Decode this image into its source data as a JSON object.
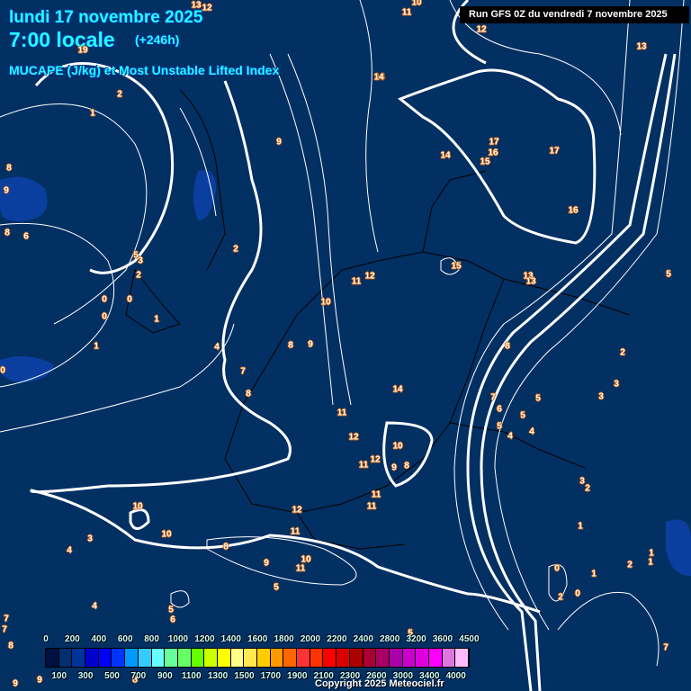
{
  "header": {
    "date": "lundi 17 novembre 2025",
    "time": "7:00 locale",
    "lead": "(+246h)",
    "parameter": "MUCAPE (J/kg) et Most Unstable Lifted Index",
    "run": "Run GFS 0Z du vendredi 7 novembre 2025"
  },
  "contour_labels": [
    "13",
    "12",
    "11",
    "10",
    "12",
    "14",
    "13",
    "19",
    "2",
    "1",
    "9",
    "8",
    "9",
    "8",
    "6",
    "5",
    "3",
    "2",
    "0",
    "0",
    "0",
    "1",
    "1",
    "2",
    "4",
    "7",
    "8",
    "8",
    "9",
    "10",
    "11",
    "12",
    "14",
    "15",
    "17",
    "16",
    "17",
    "16",
    "14",
    "15",
    "13",
    "13",
    "5",
    "8",
    "7",
    "6",
    "5",
    "5",
    "4",
    "4",
    "5",
    "3",
    "2",
    "3",
    "3",
    "2",
    "1",
    "1",
    "0",
    "0",
    "2",
    "2",
    "1",
    "1",
    "14",
    "11",
    "12",
    "11",
    "10",
    "9",
    "8",
    "12",
    "11",
    "11",
    "12",
    "11",
    "10",
    "10",
    "8",
    "4",
    "3",
    "9",
    "5",
    "6",
    "4",
    "5",
    "10",
    "11",
    "7",
    "8",
    "9",
    "7",
    "9",
    "8",
    "7",
    "5",
    "0"
  ],
  "colorbar": {
    "colors": [
      "#001040",
      "#003070",
      "#003399",
      "#0000cc",
      "#0000ff",
      "#0033ff",
      "#0099ff",
      "#33ccff",
      "#66ffff",
      "#66ff99",
      "#66ff66",
      "#66ff00",
      "#ccff00",
      "#ffff00",
      "#ffff88",
      "#ffe850",
      "#ffcc00",
      "#ff9900",
      "#ff6600",
      "#ff3333",
      "#ff3300",
      "#ff0000",
      "#dd0000",
      "#aa0000",
      "#aa0033",
      "#aa0066",
      "#aa00aa",
      "#cc00cc",
      "#dd00dd",
      "#ff00ff",
      "#dd77dd",
      "#ffbbff"
    ],
    "top_ticks": [
      "0",
      "200",
      "400",
      "600",
      "800",
      "1000",
      "1200",
      "1400",
      "1600",
      "1800",
      "2000",
      "2200",
      "2400",
      "2800",
      "3200",
      "3600",
      "4500"
    ],
    "bottom_ticks": [
      "100",
      "300",
      "500",
      "700",
      "900",
      "1100",
      "1300",
      "1500",
      "1700",
      "1900",
      "2100",
      "2300",
      "2600",
      "3000",
      "3400",
      "4000"
    ]
  },
  "copyright": "Copyright 2025 Meteociel.fr"
}
